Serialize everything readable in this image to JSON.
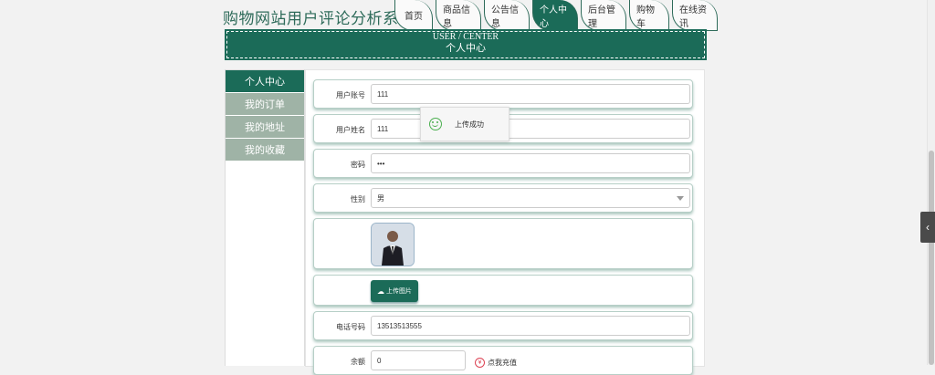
{
  "site": {
    "title": "购物网站用户评论分析系统"
  },
  "nav": {
    "items": [
      {
        "label": "首页"
      },
      {
        "label": "商品信息"
      },
      {
        "label": "公告信息"
      },
      {
        "label": "个人中心"
      },
      {
        "label": "后台管理"
      },
      {
        "label": "购物车"
      },
      {
        "label": "在线资讯"
      }
    ],
    "active_index": 3
  },
  "banner": {
    "en": "USER / CENTER",
    "cn": "个人中心"
  },
  "sidebar": {
    "items": [
      {
        "label": "个人中心"
      },
      {
        "label": "我的订单"
      },
      {
        "label": "我的地址"
      },
      {
        "label": "我的收藏"
      }
    ]
  },
  "form": {
    "account": {
      "label": "用户账号",
      "value": "111"
    },
    "name": {
      "label": "用户姓名",
      "value": "111"
    },
    "password": {
      "label": "密码",
      "value": "•••"
    },
    "gender": {
      "label": "性别",
      "value": "男"
    },
    "upload": {
      "label": "上传图片",
      "icon": "cloud-upload-icon"
    },
    "phone": {
      "label": "电话号码",
      "value": "13513513555"
    },
    "balance": {
      "label": "余额",
      "value": "0",
      "recharge_label": "点我充值",
      "recharge_icon": "yen-icon"
    }
  },
  "toast": {
    "text": "上传成功",
    "icon": "smile-icon"
  },
  "colors": {
    "primary": "#1b6b58",
    "sidebar_inactive": "#9fb3a6",
    "row_shadow": "#a9c6bd"
  }
}
